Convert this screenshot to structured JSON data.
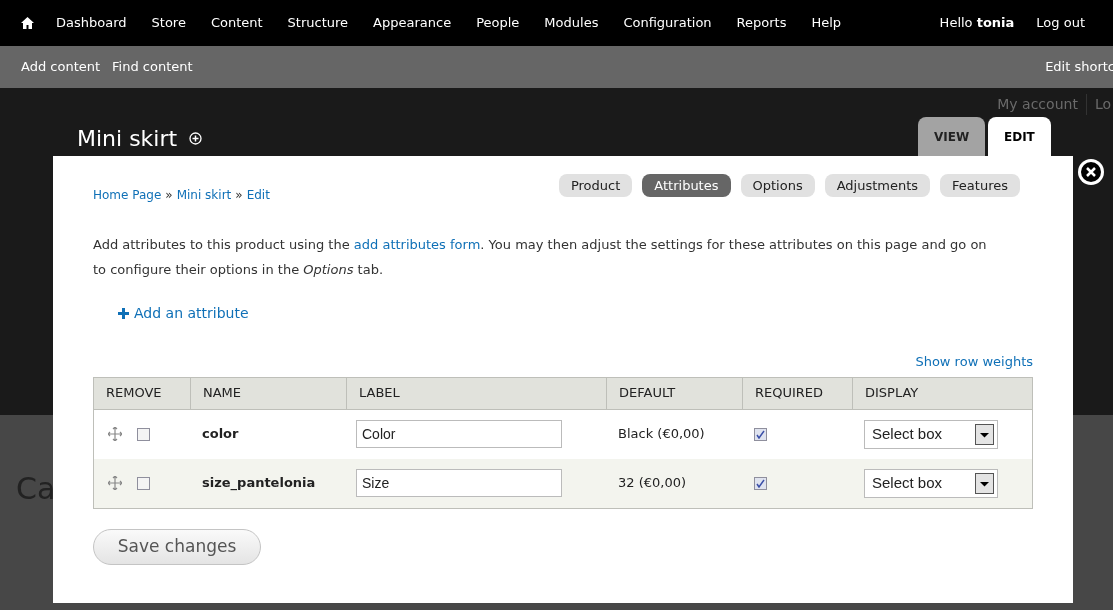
{
  "toolbar": {
    "menu": [
      "Dashboard",
      "Store",
      "Content",
      "Structure",
      "Appearance",
      "People",
      "Modules",
      "Configuration",
      "Reports",
      "Help"
    ],
    "greeting": "Hello **tonia**",
    "logout": "Log out"
  },
  "shortcuts": {
    "items": [
      "Add content",
      "Find content"
    ],
    "edit": "Edit shortc"
  },
  "background": {
    "user_links": [
      "My account",
      "Lo"
    ],
    "heading": "Ca"
  },
  "page": {
    "title": "Mini skirt",
    "tabs": [
      {
        "label": "VIEW",
        "selected": false
      },
      {
        "label": "EDIT",
        "selected": true
      }
    ]
  },
  "dialog": {
    "breadcrumb": [
      "Home Page",
      "Mini skirt",
      "Edit"
    ],
    "breadcrumb_separator": "»",
    "tabs": [
      {
        "label": "Product",
        "selected": false
      },
      {
        "label": "Attributes",
        "selected": true
      },
      {
        "label": "Options",
        "selected": false
      },
      {
        "label": "Adjustments",
        "selected": false
      },
      {
        "label": "Features",
        "selected": false
      }
    ],
    "description": {
      "before": "Add attributes to this product using the",
      "link": "add attributes form",
      "after": ". You may then adjust the settings for these attributes on this page and go on to configure their options in the *Options* tab."
    },
    "add_link": "Add an attribute",
    "row_weights": "Show row weights",
    "table": {
      "columns": [
        "REMOVE",
        "NAME",
        "LABEL",
        "DEFAULT",
        "REQUIRED",
        "DISPLAY"
      ],
      "rows": [
        {
          "remove": false,
          "name": "color",
          "label": "Color",
          "default": "Black (€0,00)",
          "required": true,
          "display": "Select box"
        },
        {
          "remove": false,
          "name": "size_pantelonia",
          "label": "Size",
          "default": "32 (€0,00)",
          "required": true,
          "display": "Select box"
        }
      ]
    },
    "save": "Save changes"
  }
}
